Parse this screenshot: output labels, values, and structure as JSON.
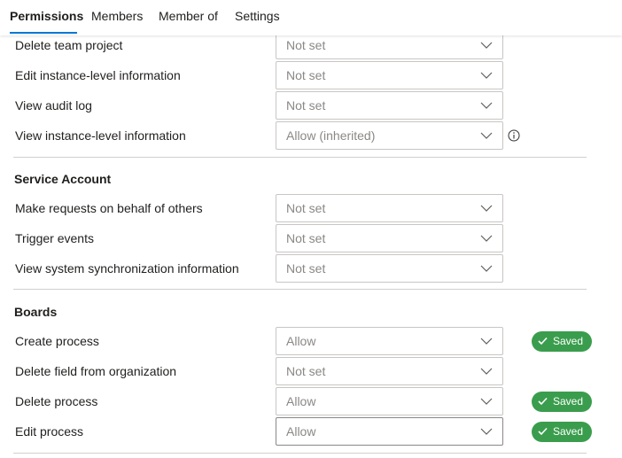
{
  "tabs": [
    "Permissions",
    "Members",
    "Member of",
    "Settings"
  ],
  "section1": {
    "rows": [
      {
        "label": "Delete team project",
        "value": "Not set"
      },
      {
        "label": "Edit instance-level information",
        "value": "Not set"
      },
      {
        "label": "View audit log",
        "value": "Not set"
      },
      {
        "label": "View instance-level information",
        "value": "Allow (inherited)"
      }
    ]
  },
  "section2": {
    "title": "Service Account",
    "rows": [
      {
        "label": "Make requests on behalf of others",
        "value": "Not set"
      },
      {
        "label": "Trigger events",
        "value": "Not set"
      },
      {
        "label": "View system synchronization information",
        "value": "Not set"
      }
    ]
  },
  "section3": {
    "title": "Boards",
    "rows": [
      {
        "label": "Create process",
        "value": "Allow",
        "status": "Saved"
      },
      {
        "label": "Delete field from organization",
        "value": "Not set"
      },
      {
        "label": "Delete process",
        "value": "Allow",
        "status": "Saved"
      },
      {
        "label": "Edit process",
        "value": "Allow",
        "status": "Saved"
      }
    ]
  },
  "colors": {
    "accent": "#0078d4",
    "saved_badge": "#3a9d4d",
    "divider": "#d2d0ce",
    "dropdown_text": "#8a8886"
  },
  "icons": {
    "chevron": "chevron-down-icon",
    "info": "info-icon",
    "check": "checkmark-icon"
  }
}
